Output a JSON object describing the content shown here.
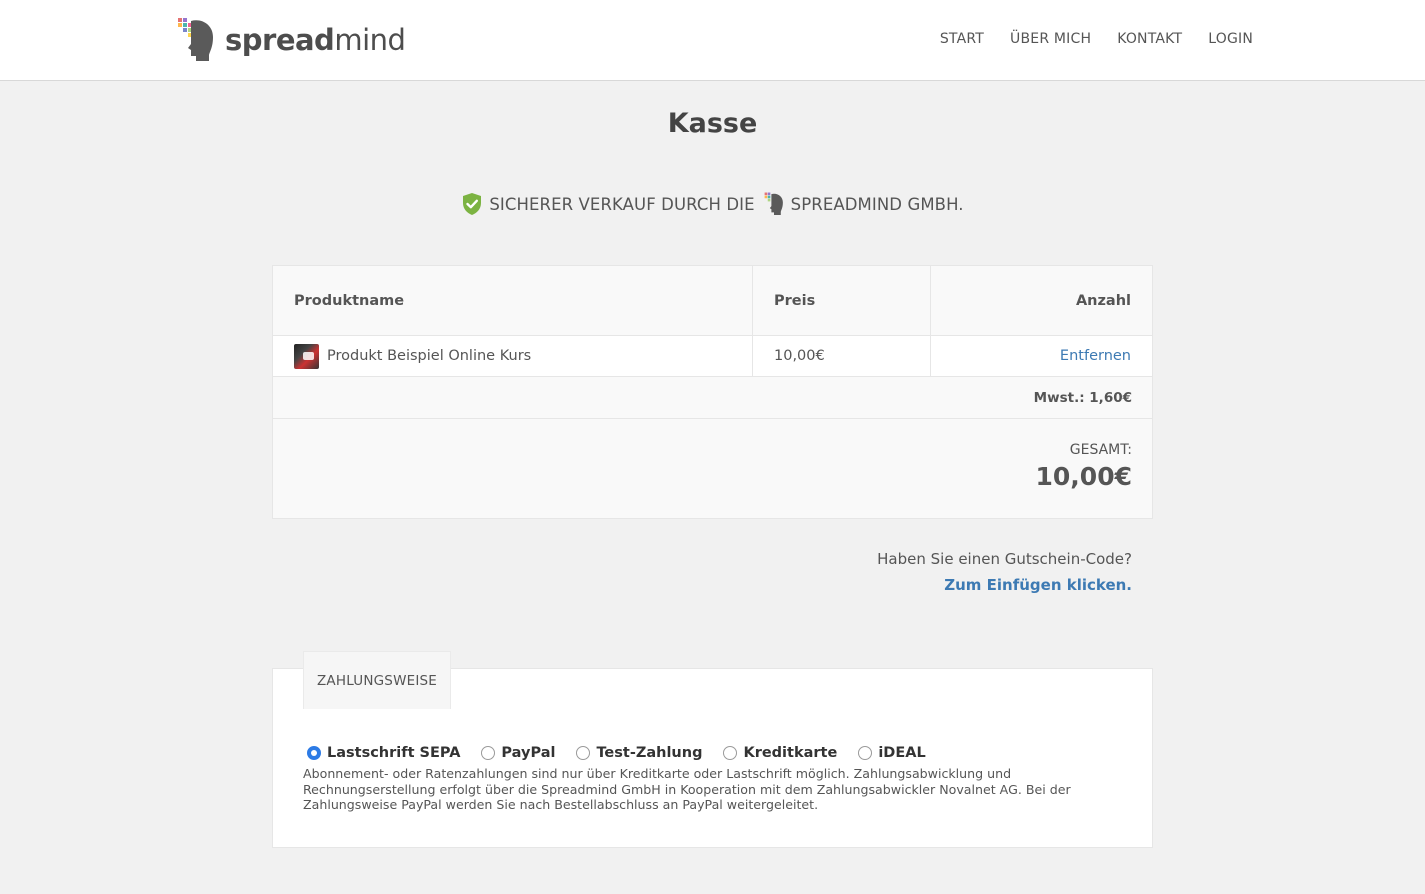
{
  "header": {
    "brand": {
      "bold": "spread",
      "light": "mind"
    },
    "nav": [
      {
        "label": "START"
      },
      {
        "label": "ÜBER MICH"
      },
      {
        "label": "KONTAKT"
      },
      {
        "label": "LOGIN"
      }
    ]
  },
  "page": {
    "title": "Kasse",
    "secure_text_before": "SICHERER VERKAUF DURCH DIE",
    "secure_text_after": "SPREADMIND GMBH."
  },
  "cart": {
    "columns": [
      "Produktname",
      "Preis",
      "Anzahl"
    ],
    "items": [
      {
        "name": "Produkt Beispiel Online Kurs",
        "price": "10,00€",
        "action": "Entfernen"
      }
    ],
    "tax": "Mwst.: 1,60€",
    "total_label": "GESAMT:",
    "total_value": "10,00€"
  },
  "coupon": {
    "question": "Haben Sie einen Gutschein-Code?",
    "link": "Zum Einfügen klicken."
  },
  "payment": {
    "tab_label": "ZAHLUNGSWEISE",
    "options": [
      {
        "label": "Lastschrift SEPA",
        "checked": true
      },
      {
        "label": "PayPal",
        "checked": false
      },
      {
        "label": "Test-Zahlung",
        "checked": false
      },
      {
        "label": "Kreditkarte",
        "checked": false
      },
      {
        "label": "iDEAL",
        "checked": false
      }
    ],
    "note": "Abonnement- oder Ratenzahlungen sind nur über Kreditkarte oder Lastschrift möglich. Zahlungsabwicklung und Rechnungserstellung erfolgt über die Spreadmind GmbH in Kooperation mit dem Zahlungsabwickler Novalnet AG. Bei der Zahlungsweise PayPal werden Sie nach Bestellabschluss an PayPal weitergeleitet."
  },
  "colors": {
    "accent_link": "#3d7ab3",
    "radio_checked": "#2d7be5",
    "shield_green": "#7cb342",
    "background": "#f1f1f1"
  }
}
